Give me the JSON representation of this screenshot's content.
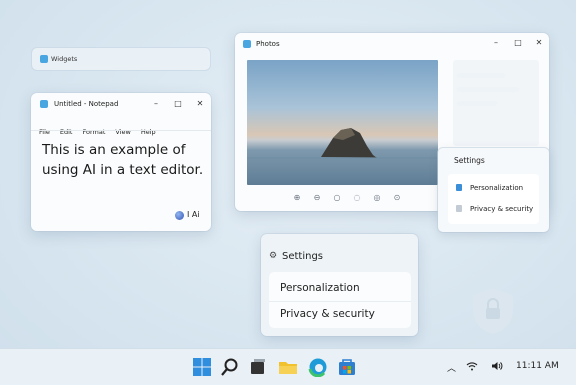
{
  "widgets": {
    "label": "Widgets"
  },
  "notepad": {
    "title": "Untitled - Notepad",
    "menu": [
      "File",
      "Edit",
      "Format",
      "View",
      "Help"
    ],
    "text": "This is an example of using AI in a text editor.",
    "ai_badge": "I Ai"
  },
  "photos": {
    "title": "Photos",
    "tools": [
      "zoom-in-icon",
      "zoom-out-icon",
      "rotate-icon",
      "crop-icon",
      "edit-icon",
      "share-icon"
    ]
  },
  "settings_panel": {
    "title": "Settings",
    "items": [
      {
        "label": "Personalization",
        "icon": "palette-icon",
        "color": "#3b8ed8"
      },
      {
        "label": "Privacy & security",
        "icon": "lock-icon",
        "color": "#8fa0b0"
      }
    ]
  },
  "settings": {
    "title": "Settings",
    "items": [
      "Personalization",
      "Privacy & security"
    ]
  },
  "taskbar": {
    "apps": [
      "windows-start-icon",
      "search-icon",
      "task-view-icon",
      "file-explorer-icon",
      "edge-icon",
      "store-icon"
    ],
    "time": "11:11 AM"
  },
  "colors": {
    "accent": "#2f8fde",
    "folder": "#f2c12e",
    "edge": "#1f9cd8"
  }
}
